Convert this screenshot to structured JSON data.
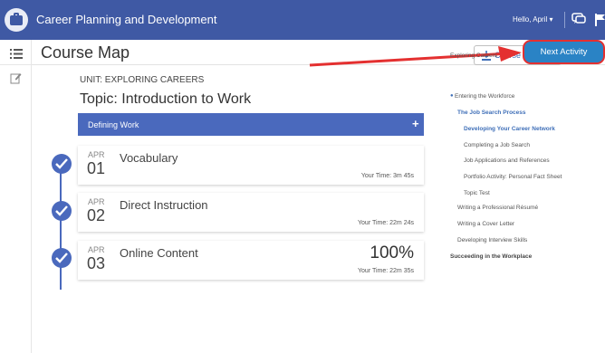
{
  "app": {
    "title": "Career Planning and Development",
    "greeting": "Hello, April ▾"
  },
  "header": {
    "page_title": "Course Map",
    "course_button_label": "Course Book",
    "next_button_label": "Next Activity"
  },
  "main": {
    "unit_label": "UNIT: EXPLORING CAREERS",
    "topic_title": "Topic: Introduction to Work",
    "section_label": "Defining Work",
    "section_plus": "+",
    "activities": [
      {
        "month": "APR",
        "day": "01",
        "title": "Vocabulary",
        "time": "Your Time: 3m 45s",
        "percent": ""
      },
      {
        "month": "APR",
        "day": "02",
        "title": "Direct Instruction",
        "time": "Your Time: 22m 24s",
        "percent": ""
      },
      {
        "month": "APR",
        "day": "03",
        "title": "Online Content",
        "time": "Your Time: 22m 35s",
        "percent": "100%"
      }
    ]
  },
  "outline": {
    "items": [
      {
        "label": "Exploring Careers",
        "level": 0,
        "state": "normal"
      },
      {
        "label": "Entering the Workforce",
        "level": 0,
        "state": "current"
      },
      {
        "label": "The Job Search Process",
        "level": 1,
        "state": "active"
      },
      {
        "label": "Developing Your Career Network",
        "level": 2,
        "state": "active"
      },
      {
        "label": "Completing a Job Search",
        "level": 2,
        "state": "normal"
      },
      {
        "label": "Job Applications and References",
        "level": 2,
        "state": "normal"
      },
      {
        "label": "Portfolio Activity: Personal Fact Sheet",
        "level": 2,
        "state": "normal"
      },
      {
        "label": "Topic Test",
        "level": 2,
        "state": "normal"
      },
      {
        "label": "Writing a Professional Résumé",
        "level": 1,
        "state": "normal"
      },
      {
        "label": "Writing a Cover Letter",
        "level": 1,
        "state": "normal"
      },
      {
        "label": "Developing Interview Skills",
        "level": 1,
        "state": "normal"
      },
      {
        "label": "Succeeding in the Workplace",
        "level": 0,
        "state": "bold"
      }
    ]
  },
  "colors": {
    "brand": "#3f59a4",
    "accent": "#4a69bd",
    "next_button": "#2a83c5",
    "highlight": "#e43030"
  },
  "icons": [
    "briefcase-logo-icon",
    "chat-icon",
    "flag-icon",
    "menu-list-icon",
    "notes-icon",
    "download-icon",
    "plus-icon",
    "check-icon"
  ]
}
